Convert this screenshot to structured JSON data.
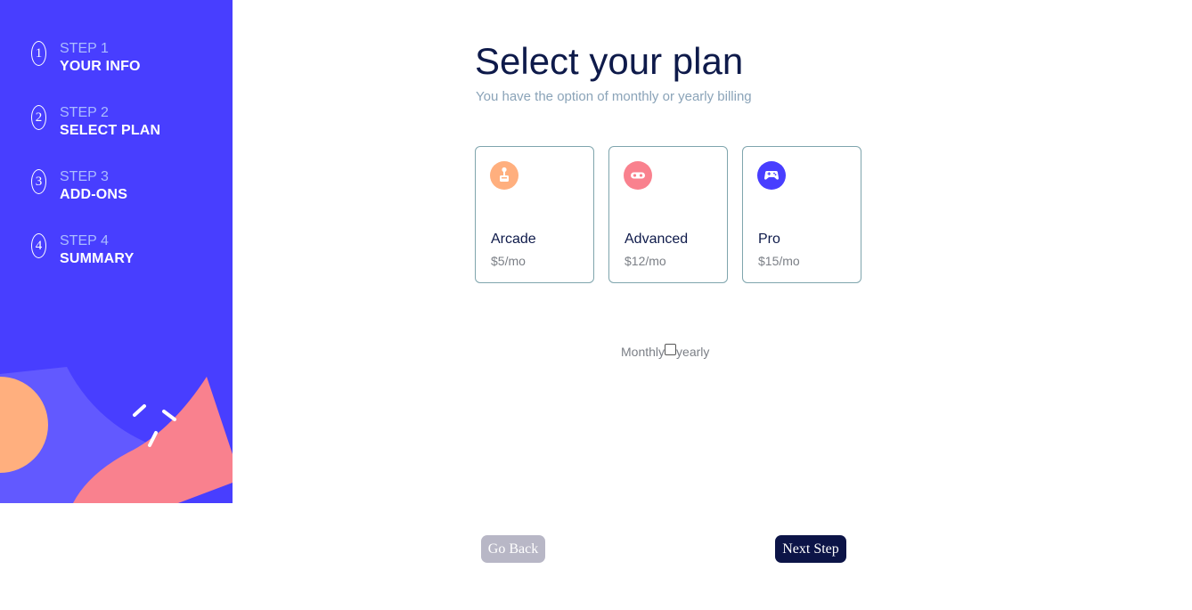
{
  "sidebar": {
    "steps": [
      {
        "number": "1",
        "label": "STEP 1",
        "title": "YOUR INFO"
      },
      {
        "number": "2",
        "label": "STEP 2",
        "title": "SELECT PLAN"
      },
      {
        "number": "3",
        "label": "STEP 3",
        "title": "ADD-ONS"
      },
      {
        "number": "4",
        "label": "STEP 4",
        "title": "SUMMARY"
      }
    ]
  },
  "main": {
    "title": "Select your plan",
    "subtitle": "You have the option of monthly or yearly billing",
    "plans": [
      {
        "name": "Arcade",
        "price": "$5/mo",
        "icon": "arcade-icon",
        "color": "#ffaf7e"
      },
      {
        "name": "Advanced",
        "price": "$12/mo",
        "icon": "advanced-icon",
        "color": "#f9818e"
      },
      {
        "name": "Pro",
        "price": "$15/mo",
        "icon": "pro-icon",
        "color": "#483eff"
      }
    ],
    "billing": {
      "monthly_label": "Monthly",
      "yearly_label": "yearly",
      "checked": false
    }
  },
  "footer": {
    "back_label": "Go Back",
    "next_label": "Next Step"
  },
  "colors": {
    "sidebar_bg": "#483eff",
    "next_button_bg": "#0c1447",
    "back_button_bg": "#b8b7c6"
  }
}
